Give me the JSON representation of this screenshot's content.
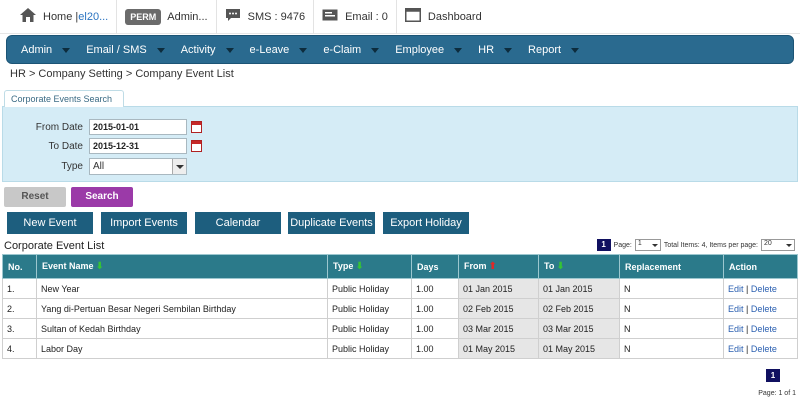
{
  "topbar": {
    "home_prefix": "Home | ",
    "home_link": "el20...",
    "perm_badge": "PERM",
    "admin_label": "Admin...",
    "sms_label": "SMS : 9476",
    "email_label": "Email : 0",
    "dashboard_label": "Dashboard"
  },
  "nav": {
    "items": [
      "Admin",
      "Email / SMS",
      "Activity",
      "e-Leave",
      "e-Claim",
      "Employee",
      "HR",
      "Report"
    ]
  },
  "breadcrumb": "HR > Company Setting > Company Event List",
  "search": {
    "tab_label": "Corporate Events Search",
    "from_label": "From Date",
    "from_value": "2015-01-01",
    "to_label": "To Date",
    "to_value": "2015-12-31",
    "type_label": "Type",
    "type_value": "All",
    "reset_label": "Reset",
    "search_label": "Search"
  },
  "actions": [
    "New Event",
    "Import Events",
    "Calendar",
    "Duplicate Events",
    "Export Holiday"
  ],
  "list": {
    "title": "Corporate Event List",
    "page_badge": "1",
    "page_label": "Page:",
    "page_value": "1",
    "total_label": "Total Items: 4, Items per page:",
    "per_page_value": "20",
    "columns": [
      "No.",
      "Event Name",
      "Type",
      "Days",
      "From",
      "To",
      "Replacement",
      "Action"
    ],
    "rows": [
      {
        "no": "1.",
        "name": "New Year",
        "type": "Public Holiday",
        "days": "1.00",
        "from": "01 Jan 2015",
        "to": "01 Jan 2015",
        "replacement": "N",
        "edit": "Edit",
        "sep": " | ",
        "delete": "Delete"
      },
      {
        "no": "2.",
        "name": "Yang di-Pertuan Besar Negeri Sembilan Birthday",
        "type": "Public Holiday",
        "days": "1.00",
        "from": "02 Feb 2015",
        "to": "02 Feb 2015",
        "replacement": "N",
        "edit": "Edit",
        "sep": " | ",
        "delete": "Delete"
      },
      {
        "no": "3.",
        "name": "Sultan of Kedah Birthday",
        "type": "Public Holiday",
        "days": "1.00",
        "from": "03 Mar 2015",
        "to": "03 Mar 2015",
        "replacement": "N",
        "edit": "Edit",
        "sep": " | ",
        "delete": "Delete"
      },
      {
        "no": "4.",
        "name": "Labor Day",
        "type": "Public Holiday",
        "days": "1.00",
        "from": "01 May 2015",
        "to": "01 May 2015",
        "replacement": "N",
        "edit": "Edit",
        "sep": " | ",
        "delete": "Delete"
      }
    ]
  },
  "footer": {
    "page_badge": "1",
    "page_text": "Page: 1 of 1"
  },
  "colors": {
    "nav_bg": "#2a6a8f",
    "table_header": "#2b7a8a",
    "action_button": "#1d5e7e",
    "search_button": "#9b3aa8",
    "panel_bg": "#d5ecf6"
  }
}
